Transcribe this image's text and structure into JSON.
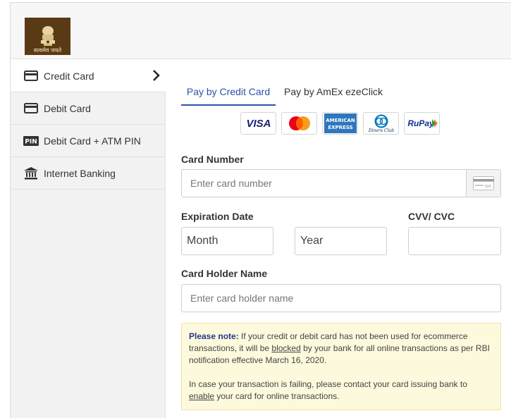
{
  "header": {
    "logo_text": "सत्यमेव जयते"
  },
  "sidebar": {
    "items": [
      {
        "label": "Credit Card",
        "icon": "credit-card-icon",
        "active": true
      },
      {
        "label": "Debit Card",
        "icon": "debit-card-icon",
        "active": false
      },
      {
        "label": "Debit Card + ATM PIN",
        "icon": "pin-icon",
        "active": false
      },
      {
        "label": "Internet Banking",
        "icon": "bank-icon",
        "active": false
      }
    ],
    "pin_badge": "PIN"
  },
  "tabs": [
    {
      "label": "Pay by Credit Card",
      "active": true
    },
    {
      "label": "Pay by AmEx ezeClick",
      "active": false
    }
  ],
  "card_brands": {
    "visa": "VISA",
    "amex_line1": "AMERICAN",
    "amex_line2": "EXPRESS",
    "diners": "Diners Club",
    "rupay": "RuPay"
  },
  "form": {
    "card_number_label": "Card Number",
    "card_number_placeholder": "Enter card number",
    "expiration_label": "Expiration Date",
    "month_value": "Month",
    "year_value": "Year",
    "cvv_label": "CVV/ CVC",
    "holder_label": "Card Holder Name",
    "holder_placeholder": "Enter card holder name"
  },
  "note": {
    "title": "Please note:",
    "p1_a": " If your credit or debit card has not been used for ecommerce transactions, it will be ",
    "p1_link": "blocked",
    "p1_b": " by your bank for all online transactions as per RBI notification effective March 16, 2020.",
    "p2_a": "In case your transaction is failing, please contact your card issuing bank to ",
    "p2_link": "enable",
    "p2_b": " your card for online transactions."
  },
  "colors": {
    "accent": "#2b53a8",
    "note_bg": "#fdf9dc",
    "logo_bg": "#5a3a14"
  }
}
